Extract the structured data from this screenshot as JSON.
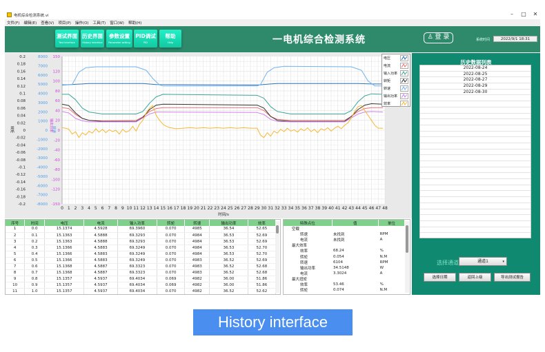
{
  "window": {
    "title": "电机综合检测系统.vi",
    "minimize": "–",
    "maximize": "□",
    "close": "✕"
  },
  "menu": [
    "文件(F)",
    "编辑(E)",
    "查看(V)",
    "项目(P)",
    "操作(O)",
    "工具(T)",
    "窗口(W)",
    "帮助(H)"
  ],
  "nav": [
    {
      "cn": "测试界面",
      "en": "Test interface"
    },
    {
      "cn": "历史界面",
      "en": "History interface"
    },
    {
      "cn": "参数设置",
      "en": "Parameter setting"
    },
    {
      "cn": "PID调试",
      "en": "PID"
    },
    {
      "cn": "帮助",
      "en": "Help"
    }
  ],
  "header": {
    "title": "一电机综合检测系统",
    "login": "登 录",
    "systime_label": "系统时间",
    "systime": "2022/9/1 18:31"
  },
  "chart_data": {
    "type": "line",
    "xlabel": "时间/s",
    "xlim": [
      0,
      48
    ],
    "xticks": [
      0,
      1,
      2,
      3,
      4,
      5,
      6,
      7,
      8,
      9,
      10,
      11,
      12,
      13,
      14,
      15,
      16,
      17,
      18,
      19,
      20,
      21,
      22,
      23,
      24,
      25,
      26,
      27,
      28,
      29,
      30,
      31,
      32,
      33,
      34,
      35,
      36,
      37,
      38,
      39,
      40,
      41,
      42,
      43,
      44,
      45,
      46,
      47,
      48
    ],
    "grid": true,
    "legend": "top-right",
    "axes": [
      {
        "label": "转矩",
        "color": "#222222",
        "ticks": [
          "0.2",
          "0.18",
          "0.16",
          "0.14",
          "0.12",
          "0.1",
          "0.08",
          "0.06",
          "0.04",
          "0.02",
          "0",
          "-0.02",
          "-0.04",
          "-0.06",
          "-0.08",
          "-0.1",
          "-0.12",
          "-0.14",
          "-0.16",
          "-0.18",
          "-0.2"
        ],
        "ylim": [
          -0.2,
          0.2
        ]
      },
      {
        "label": "转速",
        "color": "#4a9ae8",
        "ticks": [
          "8000",
          "7000",
          "6000",
          "5000",
          "4000",
          "3000",
          "2000",
          "1000",
          "0",
          "-1000",
          "-2000",
          "-3000",
          "-4000",
          "-5000",
          "-6000",
          "-7000",
          "-8000"
        ],
        "ylim": [
          -8000,
          8000
        ]
      },
      {
        "label": "输出功率",
        "color": "#d040d8",
        "ticks": [
          "150",
          "120",
          "100",
          "80",
          "60",
          "40",
          "20",
          "0",
          "-20",
          "-40",
          "-60",
          "-80",
          "-100",
          "-120",
          "-150"
        ],
        "ylim": [
          -150,
          150
        ]
      }
    ],
    "series": [
      {
        "name": "电压",
        "color": "#2a6fb8",
        "points": [
          [
            0,
            92
          ],
          [
            3,
            94
          ],
          [
            4,
            95
          ],
          [
            12,
            95
          ],
          [
            14,
            93
          ],
          [
            29,
            92
          ],
          [
            31,
            94
          ],
          [
            32,
            95
          ],
          [
            44,
            95
          ],
          [
            46,
            94
          ],
          [
            47.7,
            94
          ]
        ]
      },
      {
        "name": "电流",
        "color": "#f07070",
        "points": [
          [
            0,
            46
          ],
          [
            1,
            44
          ],
          [
            2,
            32
          ],
          [
            3,
            24
          ],
          [
            4,
            20
          ],
          [
            6,
            19
          ],
          [
            11,
            20
          ],
          [
            12,
            27
          ],
          [
            13,
            38
          ],
          [
            14,
            44
          ],
          [
            15,
            46
          ],
          [
            29,
            46
          ],
          [
            30,
            40
          ],
          [
            31,
            28
          ],
          [
            32,
            22
          ],
          [
            34,
            20
          ],
          [
            42,
            20
          ],
          [
            43,
            28
          ],
          [
            44,
            38
          ],
          [
            45,
            44
          ],
          [
            46,
            46
          ],
          [
            47.7,
            46
          ]
        ]
      },
      {
        "name": "输入功率",
        "color": "#3aa598",
        "points": [
          [
            0,
            73
          ],
          [
            1,
            73
          ],
          [
            2,
            62
          ],
          [
            3,
            45
          ],
          [
            4,
            37
          ],
          [
            6,
            33
          ],
          [
            11,
            33
          ],
          [
            12,
            38
          ],
          [
            13,
            55
          ],
          [
            14,
            68
          ],
          [
            15,
            73
          ],
          [
            29,
            71
          ],
          [
            30,
            65
          ],
          [
            31,
            48
          ],
          [
            32,
            38
          ],
          [
            34,
            33
          ],
          [
            42,
            33
          ],
          [
            43,
            40
          ],
          [
            44,
            58
          ],
          [
            45,
            70
          ],
          [
            46,
            74
          ],
          [
            47.7,
            73
          ]
        ]
      },
      {
        "name": "转矩",
        "color": "#333333",
        "points": [
          [
            0,
            53
          ],
          [
            1,
            50
          ],
          [
            2,
            35
          ],
          [
            3,
            24
          ],
          [
            4,
            20
          ],
          [
            6,
            18
          ],
          [
            11,
            18
          ],
          [
            12,
            26
          ],
          [
            13,
            42
          ],
          [
            14,
            51
          ],
          [
            15,
            53
          ],
          [
            29,
            51
          ],
          [
            30,
            45
          ],
          [
            31,
            28
          ],
          [
            32,
            20
          ],
          [
            34,
            18
          ],
          [
            42,
            18
          ],
          [
            43,
            28
          ],
          [
            44,
            42
          ],
          [
            45,
            51
          ],
          [
            46,
            54
          ],
          [
            47.7,
            53
          ]
        ]
      },
      {
        "name": "转速",
        "color": "#70b4f0",
        "points": [
          [
            0,
            93
          ],
          [
            1.5,
            93
          ],
          [
            2.5,
            118
          ],
          [
            3.5,
            127
          ],
          [
            5,
            129
          ],
          [
            11,
            129
          ],
          [
            12.5,
            122
          ],
          [
            13.5,
            105
          ],
          [
            14.5,
            92
          ],
          [
            15,
            90
          ],
          [
            29,
            90
          ],
          [
            29.5,
            93
          ],
          [
            30.5,
            118
          ],
          [
            31.5,
            127
          ],
          [
            33,
            130
          ],
          [
            43,
            129
          ],
          [
            44.5,
            122
          ],
          [
            45.5,
            100
          ],
          [
            46.5,
            90
          ],
          [
            47.7,
            90
          ]
        ]
      },
      {
        "name": "输出功率",
        "color": "#d080f0",
        "points": [
          [
            0,
            38
          ],
          [
            1,
            35
          ],
          [
            2,
            24
          ],
          [
            3,
            19
          ],
          [
            4,
            17
          ],
          [
            6,
            17
          ],
          [
            11,
            17
          ],
          [
            12,
            25
          ],
          [
            13,
            33
          ],
          [
            14,
            37
          ],
          [
            15,
            37
          ],
          [
            29,
            36
          ],
          [
            30,
            32
          ],
          [
            31,
            22
          ],
          [
            32,
            18
          ],
          [
            34,
            17
          ],
          [
            42,
            17
          ],
          [
            43,
            25
          ],
          [
            44,
            33
          ],
          [
            45,
            37
          ],
          [
            46,
            38
          ],
          [
            47.7,
            37
          ]
        ]
      },
      {
        "name": "效率",
        "color": "#f8b830",
        "points": [
          [
            0,
            5
          ],
          [
            0.5,
            4
          ],
          [
            1,
            2
          ],
          [
            1.5,
            -8
          ],
          [
            2,
            -3
          ],
          [
            2.5,
            -15
          ],
          [
            3,
            -5
          ],
          [
            3.5,
            -10
          ],
          [
            4,
            -2
          ],
          [
            4.5,
            -6
          ],
          [
            5,
            3
          ],
          [
            5.5,
            -4
          ],
          [
            6,
            2
          ],
          [
            6.5,
            -5
          ],
          [
            7,
            1
          ],
          [
            7.5,
            -3
          ],
          [
            8,
            0
          ],
          [
            8.5,
            -8
          ],
          [
            9,
            2
          ],
          [
            9.5,
            -4
          ],
          [
            10,
            -1
          ],
          [
            10.5,
            8
          ],
          [
            11,
            -2
          ],
          [
            11.5,
            12
          ],
          [
            12,
            20
          ],
          [
            12.5,
            35
          ],
          [
            13,
            45
          ],
          [
            13.5,
            50
          ],
          [
            14,
            30
          ],
          [
            14.5,
            20
          ],
          [
            15,
            12
          ],
          [
            15.5,
            8
          ],
          [
            16,
            5
          ],
          [
            17,
            3
          ],
          [
            18,
            4
          ],
          [
            19,
            5
          ],
          [
            20,
            4
          ],
          [
            21,
            5
          ],
          [
            22,
            4
          ],
          [
            23,
            5
          ],
          [
            24,
            4
          ],
          [
            25,
            5
          ],
          [
            26,
            4
          ],
          [
            27,
            5
          ],
          [
            28,
            4
          ],
          [
            29,
            4
          ],
          [
            29.5,
            -10
          ],
          [
            30,
            -15
          ],
          [
            30.5,
            -5
          ],
          [
            31,
            -12
          ],
          [
            31.5,
            -2
          ],
          [
            32,
            -6
          ],
          [
            32.5,
            2
          ],
          [
            33,
            -3
          ],
          [
            33.5,
            4
          ],
          [
            34,
            -2
          ],
          [
            34.5,
            1
          ],
          [
            35,
            -4
          ],
          [
            35.5,
            3
          ],
          [
            36,
            -1
          ],
          [
            36.5,
            5
          ],
          [
            37,
            -3
          ],
          [
            37.5,
            2
          ],
          [
            38,
            -5
          ],
          [
            38.5,
            3
          ],
          [
            39,
            0
          ],
          [
            39.5,
            5
          ],
          [
            40,
            -2
          ],
          [
            40.5,
            4
          ],
          [
            41,
            8
          ],
          [
            41.5,
            3
          ],
          [
            42,
            10
          ],
          [
            42.5,
            15
          ],
          [
            43,
            25
          ],
          [
            43.5,
            38
          ],
          [
            44,
            48
          ],
          [
            44.5,
            50
          ],
          [
            45,
            40
          ],
          [
            45.5,
            30
          ],
          [
            46,
            20
          ],
          [
            46.5,
            10
          ],
          [
            47,
            4
          ],
          [
            47.7,
            4
          ]
        ]
      }
    ]
  },
  "data_table": {
    "headers": [
      "序号",
      "时间",
      "电压",
      "电流",
      "输入功率",
      "转矩",
      "转速",
      "输出功率",
      "效率"
    ],
    "rows": [
      [
        "1",
        "0.0",
        "15.1374",
        "4.5928",
        "69.3960",
        "0.070",
        "4985",
        "36.54",
        "52.65"
      ],
      [
        "2",
        "0.1",
        "15.1363",
        "4.5888",
        "69.3293",
        "0.070",
        "4984",
        "36.53",
        "52.69"
      ],
      [
        "3",
        "0.2",
        "15.1363",
        "4.5888",
        "69.3293",
        "0.070",
        "4984",
        "36.53",
        "52.69"
      ],
      [
        "4",
        "0.3",
        "15.1366",
        "4.5883",
        "69.3249",
        "0.070",
        "4984",
        "36.53",
        "52.70"
      ],
      [
        "5",
        "0.4",
        "15.1366",
        "4.5883",
        "69.3249",
        "0.070",
        "4984",
        "36.53",
        "52.70"
      ],
      [
        "6",
        "0.5",
        "15.1366",
        "4.5883",
        "69.3249",
        "0.070",
        "4983",
        "36.52",
        "52.69"
      ],
      [
        "7",
        "0.6",
        "15.1368",
        "4.5887",
        "69.3323",
        "0.070",
        "4983",
        "36.52",
        "52.68"
      ],
      [
        "8",
        "0.7",
        "15.1368",
        "4.5887",
        "69.3323",
        "0.070",
        "4983",
        "36.52",
        "52.68"
      ],
      [
        "9",
        "0.8",
        "15.1357",
        "4.5937",
        "69.4034",
        "0.069",
        "4982",
        "36.00",
        "51.86"
      ],
      [
        "10",
        "0.9",
        "15.1357",
        "4.5937",
        "69.4034",
        "0.069",
        "4982",
        "36.00",
        "51.86"
      ],
      [
        "11",
        "1.0",
        "15.1357",
        "4.5937",
        "69.4034",
        "0.070",
        "4982",
        "36.52",
        "52.62"
      ]
    ]
  },
  "feature_table": {
    "headers": [
      "特殊点位",
      "值",
      "单位"
    ],
    "rows": [
      [
        "空载",
        "",
        ""
      ],
      [
        "转速",
        "未找到",
        "RPM"
      ],
      [
        "电流",
        "未找到",
        "A"
      ],
      [
        "最大效率",
        "",
        ""
      ],
      [
        "效率",
        "68.24",
        "%"
      ],
      [
        "转矩",
        "0.054",
        "N.M"
      ],
      [
        "转速",
        "6104",
        "RPM"
      ],
      [
        "输出功率",
        "34.5148",
        "W"
      ],
      [
        "电流",
        "3.3024",
        "A"
      ],
      [
        "最大扭矩",
        "",
        ""
      ],
      [
        "效率",
        "53.46",
        "%"
      ],
      [
        "转矩",
        "0.074",
        "N.M"
      ]
    ]
  },
  "history": {
    "title": "历史数据列表",
    "dates": [
      "2022-08-24",
      "2022-08-25",
      "2022-08-27",
      "2022-08-29",
      "2022-08-30"
    ],
    "channel_label": "选择通道",
    "channel_value": "通道1",
    "buttons": [
      "选择日期",
      "返回上级",
      "导出测试报告"
    ]
  },
  "caption": "History interface"
}
